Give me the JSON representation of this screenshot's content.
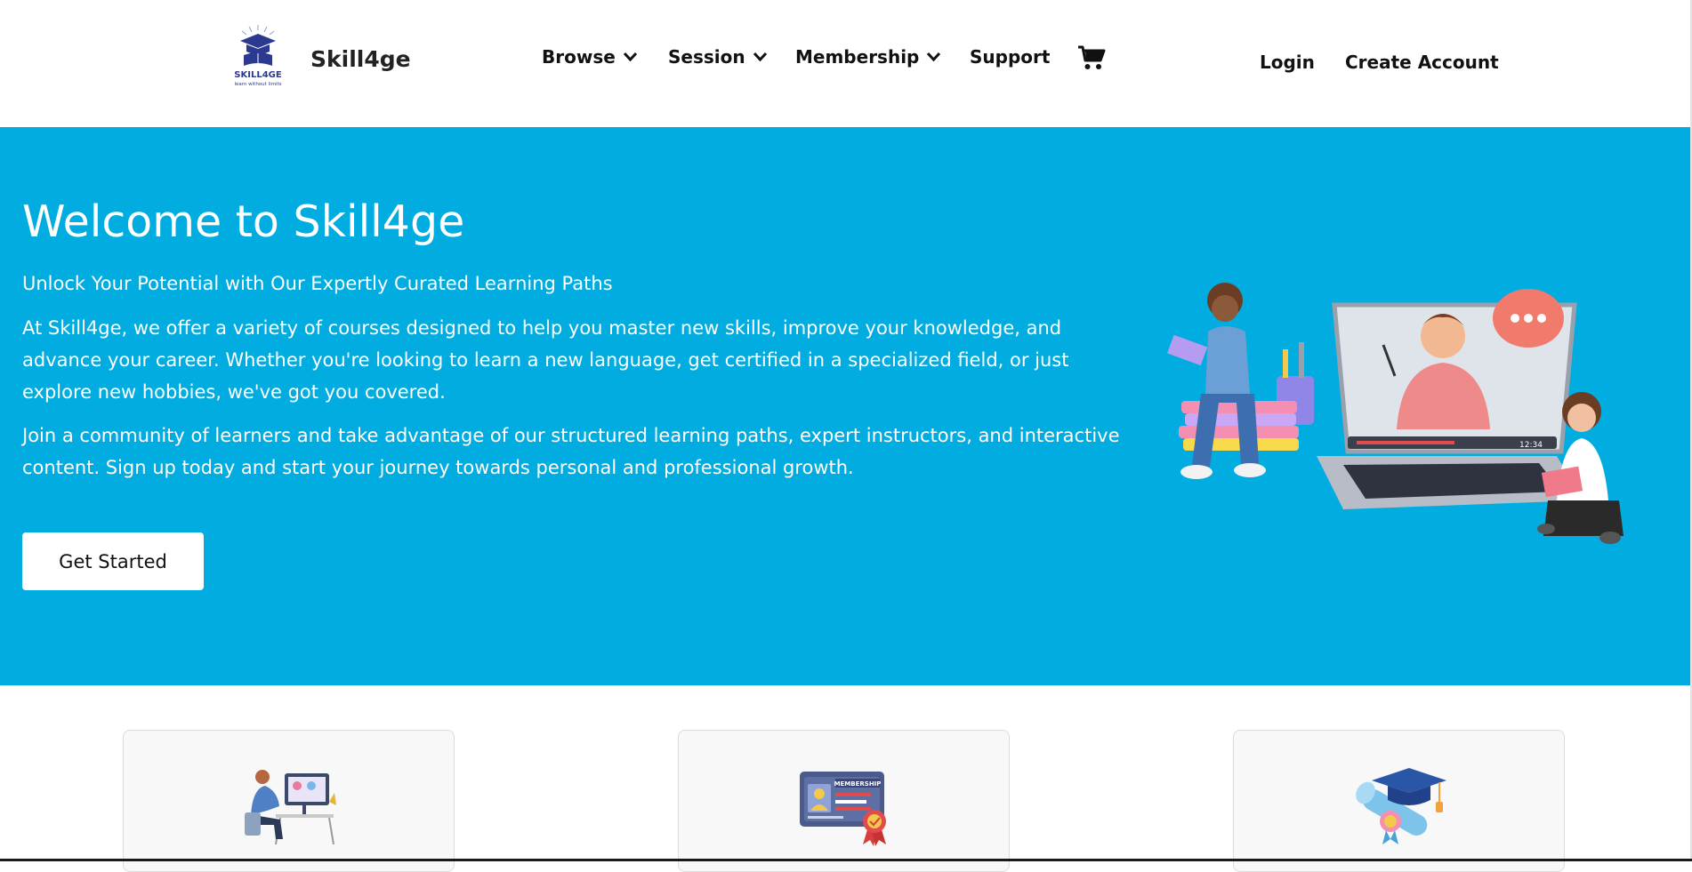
{
  "header": {
    "brand": "Skill4ge",
    "logo_text": "SKILL4GE",
    "logo_tagline": "learn without limits",
    "nav": [
      {
        "label": "Browse",
        "has_dropdown": true
      },
      {
        "label": "Session",
        "has_dropdown": true
      },
      {
        "label": "Membership",
        "has_dropdown": true
      },
      {
        "label": "Support",
        "has_dropdown": false
      }
    ],
    "cart_icon": "shopping-cart-icon",
    "login_label": "Login",
    "create_account_label": "Create Account"
  },
  "hero": {
    "title": "Welcome to Skill4ge",
    "subtitle": "Unlock Your Potential with Our Expertly Curated Learning Paths",
    "paragraph1": "At Skill4ge, we offer a variety of courses designed to help you master new skills, improve your knowledge, and advance your career. Whether you're looking to learn a new language, get certified in a specialized field, or just explore new hobbies, we've got you covered.",
    "paragraph2": "Join a community of learners and take advantage of our structured learning paths, expert instructors, and interactive content. Sign up today and start your journey towards personal and professional growth.",
    "cta_label": "Get Started",
    "illustration_time": "12:34",
    "background_color": "#00ace0"
  },
  "cards": [
    {
      "icon": "online-learning-icon"
    },
    {
      "icon": "membership-card-icon",
      "icon_text": "MEMBERSHIP"
    },
    {
      "icon": "graduation-cap-diploma-icon"
    }
  ]
}
